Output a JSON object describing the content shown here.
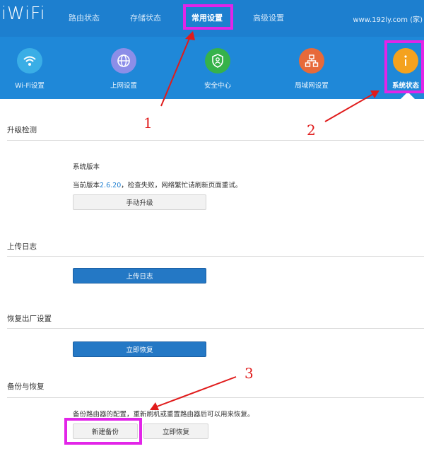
{
  "header": {
    "logo": "iWiFi",
    "tabs": [
      {
        "label": "路由状态"
      },
      {
        "label": "存储状态"
      },
      {
        "label": "常用设置"
      },
      {
        "label": "高级设置"
      }
    ],
    "hostname": "www.192ly.com (家)"
  },
  "iconbar": {
    "items": [
      {
        "label": "Wi-Fi设置",
        "icon": "wifi-icon",
        "color": "#3aaee6"
      },
      {
        "label": "上网设置",
        "icon": "globe-icon",
        "color": "#8c8ee8"
      },
      {
        "label": "安全中心",
        "icon": "shield-icon",
        "color": "#36b24a"
      },
      {
        "label": "局域网设置",
        "icon": "network-icon",
        "color": "#e76a3a"
      },
      {
        "label": "系统状态",
        "icon": "info-icon",
        "color": "#f4a21e"
      }
    ]
  },
  "sections": {
    "upgrade": {
      "title": "升级检测",
      "version_label": "系统版本",
      "status_prefix": "当前版本",
      "version": "2.6.20",
      "status_suffix": "，检查失败，网络繁忙请刷新页面重试。",
      "button": "手动升级"
    },
    "log": {
      "title": "上传日志",
      "button": "上传日志"
    },
    "reset": {
      "title": "恢复出厂设置",
      "button": "立即恢复"
    },
    "backup": {
      "title": "备份与恢复",
      "description": "备份路由器的配置，重新刷机或重置路由器后可以用来恢复。",
      "new_backup": "新建备份",
      "restore": "立即恢复"
    }
  },
  "annotations": {
    "labels": [
      "1",
      "2",
      "3"
    ],
    "color": "#e01b1b",
    "highlight": "#e225e8"
  }
}
